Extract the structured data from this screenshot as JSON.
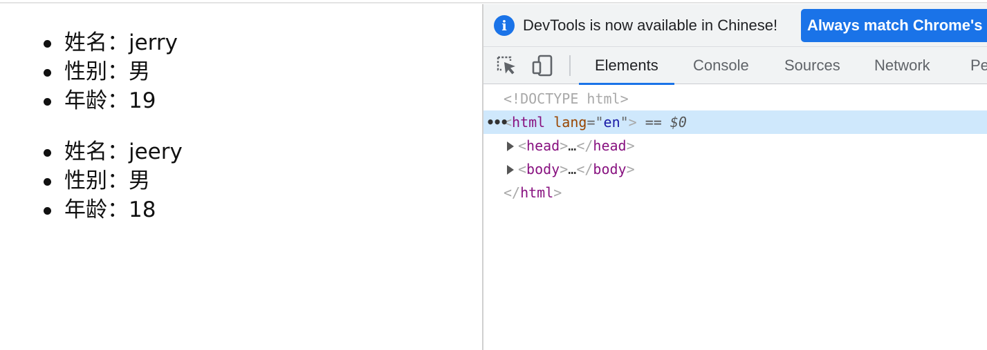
{
  "page": {
    "lists": [
      {
        "items": [
          "姓名：jerry",
          "性别：男",
          "年龄：19"
        ]
      },
      {
        "items": [
          "姓名：jeery",
          "性别：男",
          "年龄：18"
        ]
      }
    ]
  },
  "devtools": {
    "infobar": {
      "icon": "info-icon",
      "message": "DevTools is now available in Chinese!",
      "button_label": "Always match Chrome's language"
    },
    "toolbar": {
      "icons": [
        "inspect-element-icon",
        "device-toggle-icon"
      ],
      "tabs": [
        "Elements",
        "Console",
        "Sources",
        "Network",
        "Performance"
      ],
      "active_tab": "Elements"
    },
    "dom": {
      "doctype": "<!DOCTYPE html>",
      "html_tag": "html",
      "lang_attr": "lang",
      "lang_value": "en",
      "selected_marker": "== $0",
      "selected_dots": "•••",
      "head_tag": "head",
      "body_tag": "body",
      "ellipsis": "…"
    }
  },
  "colors": {
    "accent": "#1a73e8",
    "selected_row": "#cfe8fc",
    "tag": "#881280",
    "attr_name": "#994500",
    "attr_value": "#1a1aa6"
  }
}
